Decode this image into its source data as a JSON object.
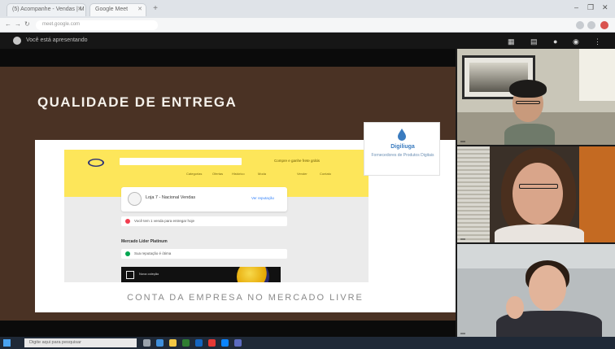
{
  "browser": {
    "tabs": [
      {
        "label": "(5) Acompanhe - Vendas | M"
      },
      {
        "label": "Google Meet"
      }
    ],
    "new_tab": "+",
    "url": "meet.google.com",
    "window_controls": [
      "–",
      "❐",
      "✕"
    ]
  },
  "meeting": {
    "presenter_text": "Você está apresentando",
    "icon_names": [
      "grid-icon",
      "chat-icon",
      "person-icon",
      "more-icon"
    ]
  },
  "slide": {
    "title": "QUALIDADE DE ENTREGA",
    "logo_name": "Digiliuga",
    "logo_sub": "Fornecedores de Produtos Digitais",
    "caption": "CONTA DA EMPRESA NO MERCADO LIVRE",
    "embedded": {
      "store_name": "Loja 7 - Nacional Vendas",
      "link": "Ver reputação",
      "promo": "Compre e ganhe frete grátis",
      "nav_items": [
        "Categorias",
        "Ofertas",
        "Histórico",
        "Moda",
        "Vender",
        "Contato"
      ],
      "row_1": "Você tem 1 venda para entregar hoje",
      "row_2": "Sua reputação é ótima",
      "section": "Mercado Líder Platinum",
      "banner_text": "Nova coleção"
    }
  },
  "participants": [
    {
      "name": ""
    },
    {
      "name": ""
    },
    {
      "name": ""
    }
  ],
  "taskbar": {
    "search_placeholder": "Digite aqui para pesquisar",
    "tray_time": ""
  },
  "colors": {
    "slide_bg": "#4a3224",
    "ml_yellow": "#fde65a",
    "meet_bar": "#161616"
  }
}
